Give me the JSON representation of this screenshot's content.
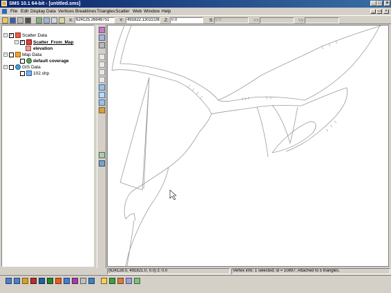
{
  "window": {
    "title": "SMS 10.1 64-bit - [untitled.sms]",
    "controls": {
      "minimize": "_",
      "maximize": "□",
      "close": "×"
    },
    "mdi_controls": {
      "minimize": "_",
      "restore": "▭",
      "close": "×"
    }
  },
  "menu": {
    "items": [
      "File",
      "Edit",
      "Display",
      "Data",
      "Vertices",
      "Breaklines",
      "Triangles",
      "Scatter",
      "Web",
      "Window",
      "Help"
    ]
  },
  "coords": {
    "x_label": "X:",
    "x_value": "624125.26649751",
    "y_label": "Y:",
    "y_value": "491822.13022198",
    "z_label": "Z:",
    "z_value": "0.0",
    "s_label": "S:",
    "s_value": "0.0",
    "vx_label": "Vx:",
    "vx_value": "",
    "vy_label": "Vy:",
    "vy_value": ""
  },
  "tree": {
    "scatter_data": "Scatter Data",
    "scatter_from_map": "Scatter_From_Map",
    "elevation": "elevation",
    "map_data": "Map Data",
    "default_coverage": "default coverage",
    "gis_data": "GIS Data",
    "shp": "102.shp",
    "expand_minus": "−",
    "check_mark": "✓"
  },
  "status": {
    "position": "(624128.0, 491821.0, 0.0) z: 0.0",
    "vertex_info": "Vertex info: 1 selected; id = 10897; Attached to 5 triangles."
  },
  "colors": {
    "title_start": "#0a246a",
    "title_end": "#3a6ea5",
    "chrome": "#d4d0c8",
    "canvas": "#ffffff",
    "line": "#9a9a9a"
  }
}
